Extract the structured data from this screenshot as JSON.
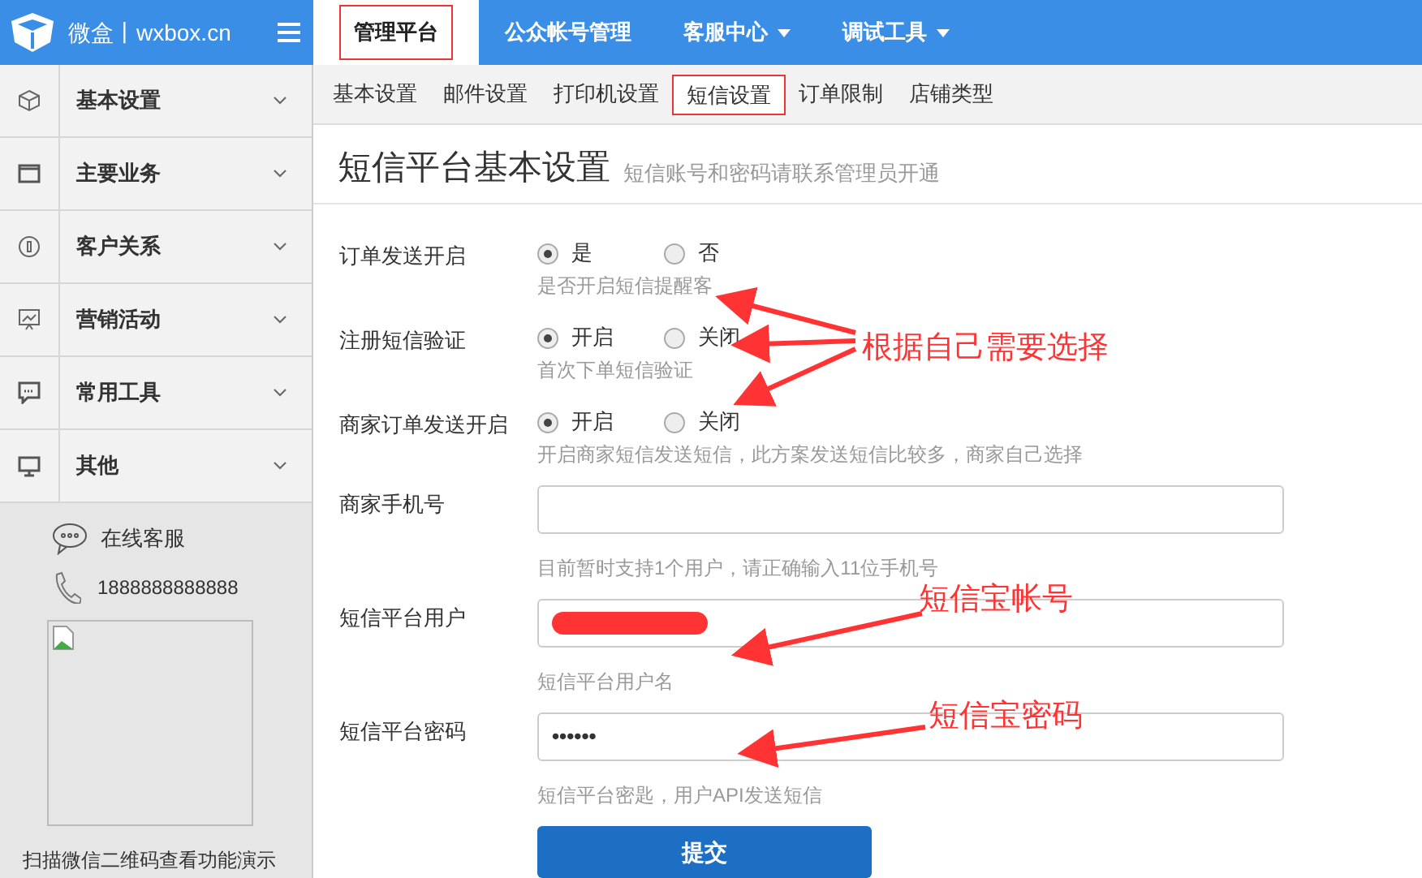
{
  "logo": {
    "text": "微盒丨wxbox.cn"
  },
  "top_nav": [
    {
      "label": "管理平台",
      "selected": true,
      "dropdown": false
    },
    {
      "label": "公众帐号管理",
      "selected": false,
      "dropdown": false
    },
    {
      "label": "客服中心",
      "selected": false,
      "dropdown": true
    },
    {
      "label": "调试工具",
      "selected": false,
      "dropdown": true
    }
  ],
  "sidebar": {
    "items": [
      {
        "label": "基本设置"
      },
      {
        "label": "主要业务"
      },
      {
        "label": "客户关系"
      },
      {
        "label": "营销活动"
      },
      {
        "label": "常用工具"
      },
      {
        "label": "其他"
      }
    ],
    "support": {
      "online": "在线客服",
      "phone": "1888888888888",
      "qr_caption": "扫描微信二维码查看功能演示"
    }
  },
  "sub_tabs": [
    {
      "label": "基本设置",
      "selected": false
    },
    {
      "label": "邮件设置",
      "selected": false
    },
    {
      "label": "打印机设置",
      "selected": false
    },
    {
      "label": "短信设置",
      "selected": true
    },
    {
      "label": "订单限制",
      "selected": false
    },
    {
      "label": "店铺类型",
      "selected": false
    }
  ],
  "page": {
    "title": "短信平台基本设置",
    "subtitle": "短信账号和密码请联系管理员开通"
  },
  "form": [
    {
      "kind": "radio",
      "label": "订单发送开启",
      "options": [
        {
          "label": "是",
          "selected": true
        },
        {
          "label": "否",
          "selected": false
        }
      ],
      "help": "是否开启短信提醒客"
    },
    {
      "kind": "radio",
      "label": "注册短信验证",
      "options": [
        {
          "label": "开启",
          "selected": true
        },
        {
          "label": "关闭",
          "selected": false
        }
      ],
      "help": "首次下单短信验证"
    },
    {
      "kind": "radio",
      "label": "商家订单发送开启",
      "options": [
        {
          "label": "开启",
          "selected": true
        },
        {
          "label": "关闭",
          "selected": false
        }
      ],
      "help": "开启商家短信发送短信，此方案发送短信比较多，商家自己选择"
    },
    {
      "kind": "text",
      "label": "商家手机号",
      "help": "目前暂时支持1个用户，请正确输入11位手机号"
    },
    {
      "kind": "text",
      "label": "短信平台用户",
      "redacted": true,
      "help": "短信平台用户名"
    },
    {
      "kind": "text",
      "label": "短信平台密码",
      "value": "••••••",
      "help": "短信平台密匙，用户API发送短信"
    }
  ],
  "submit": "提交",
  "annotations": [
    {
      "text": "根据自己需要选择"
    },
    {
      "text": "短信宝帐号"
    },
    {
      "text": "短信宝密码"
    }
  ]
}
